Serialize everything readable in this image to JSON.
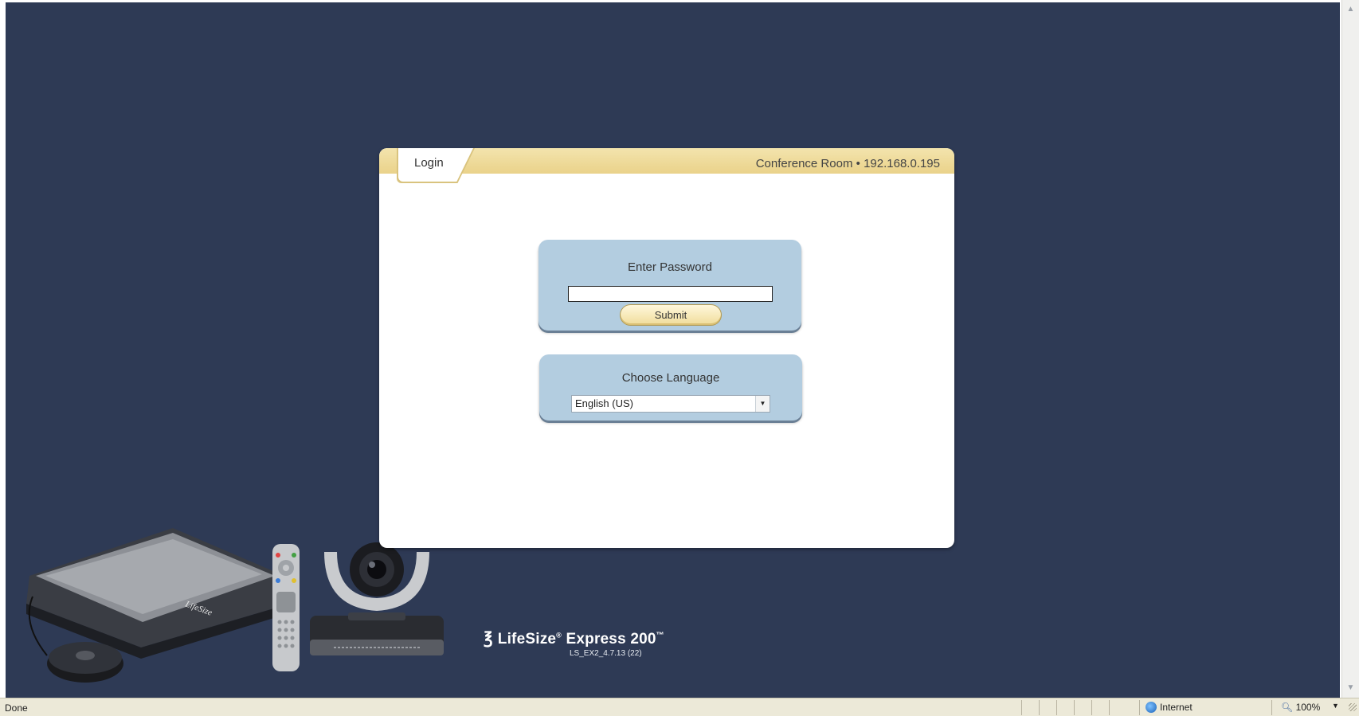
{
  "login_card": {
    "tab_label": "Login",
    "device_name": "Conference Room",
    "separator": "•",
    "ip_address": "192.168.0.195"
  },
  "password_panel": {
    "title": "Enter Password",
    "input_value": "",
    "submit_label": "Submit"
  },
  "language_panel": {
    "title": "Choose Language",
    "selected": "English (US)"
  },
  "branding": {
    "logo_glyph": "℥",
    "product_name": "LifeSize",
    "registered_mark": "®",
    "product_model": "Express 200",
    "trademark": "™",
    "version": "LS_EX2_4.7.13 (22)"
  },
  "statusbar": {
    "status": "Done",
    "zone": "Internet",
    "zoom": "100%"
  },
  "colors": {
    "page_bg": "#2e3a55",
    "header_gold": "#ead28a",
    "panel_blue": "#b3cde0"
  }
}
